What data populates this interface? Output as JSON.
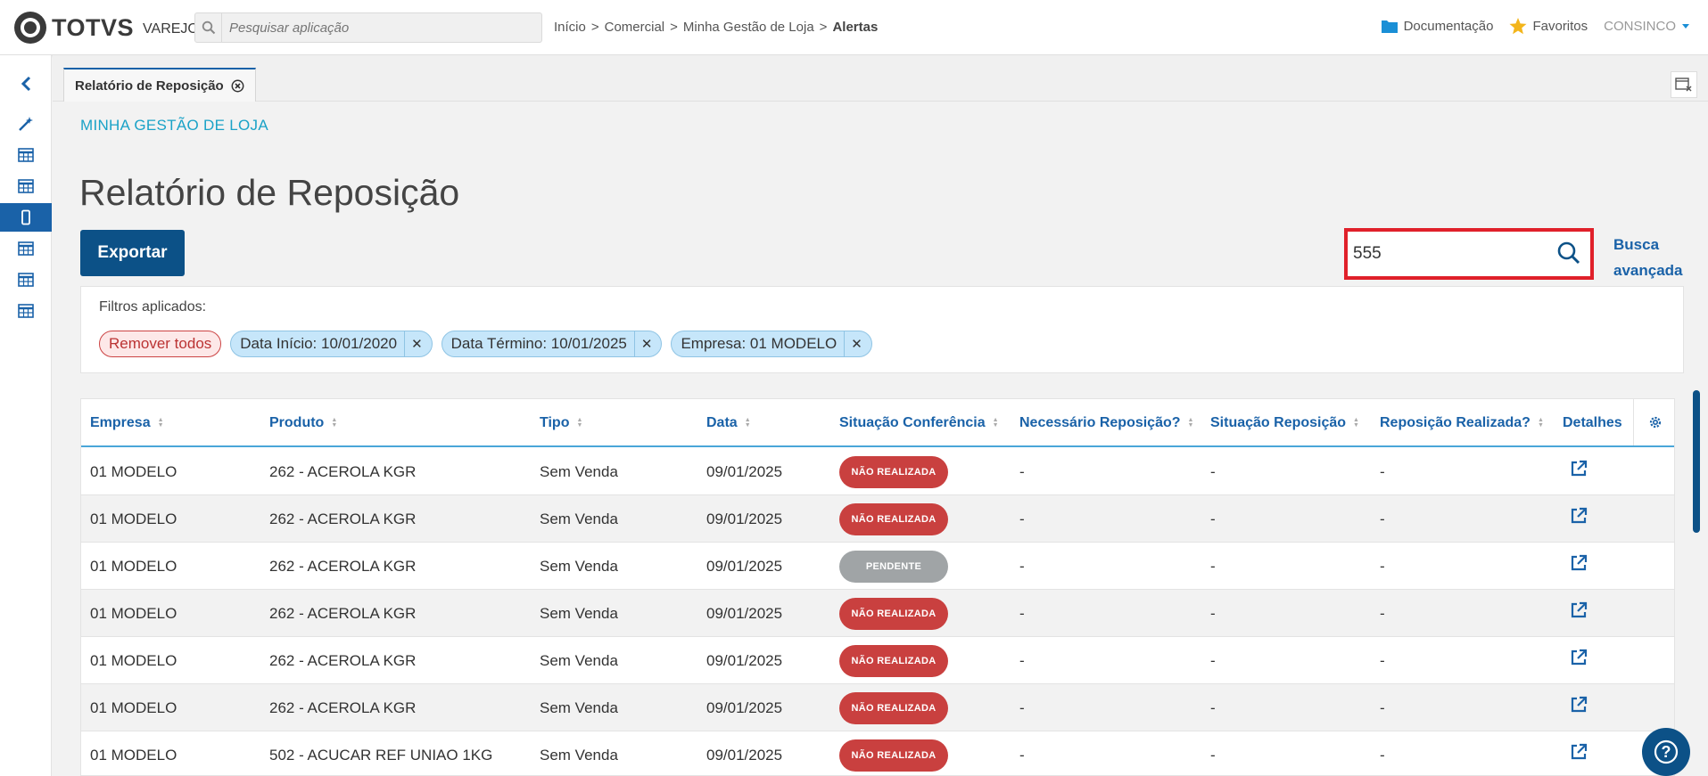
{
  "header": {
    "logo_text": "TOTVS",
    "logo_sub": "VAREJO",
    "search_placeholder": "Pesquisar aplicação",
    "breadcrumb": [
      "Início",
      ">",
      "Comercial",
      ">",
      "Minha Gestão de Loja",
      ">",
      "Alertas"
    ],
    "documentation_label": "Documentação",
    "favorites_label": "Favoritos",
    "user_label": "CONSINCO"
  },
  "tab": {
    "label": "Relatório de Reposição"
  },
  "page": {
    "section_label": "MINHA GESTÃO DE LOJA",
    "title": "Relatório de Reposição",
    "export_label": "Exportar",
    "search_value": "555",
    "advanced_search_line1": "Busca",
    "advanced_search_line2": "avançada"
  },
  "filters": {
    "title": "Filtros aplicados:",
    "remove_all_label": "Remover todos",
    "chips": [
      {
        "label": "Data Início: 10/01/2020"
      },
      {
        "label": "Data Término: 10/01/2025"
      },
      {
        "label": "Empresa: 01 MODELO"
      }
    ]
  },
  "table": {
    "columns": [
      "Empresa",
      "Produto",
      "Tipo",
      "Data",
      "Situação Conferência",
      "Necessário Reposição?",
      "Situação Reposição",
      "Reposição Realizada?",
      "Detalhes"
    ],
    "rows": [
      {
        "empresa": "01 MODELO",
        "produto": "262 - ACEROLA KGR",
        "tipo": "Sem Venda",
        "data": "09/01/2025",
        "situacao": "NÃO REALIZADA",
        "status": "red",
        "necessario": "-",
        "sit_repo": "-",
        "realizada": "-"
      },
      {
        "empresa": "01 MODELO",
        "produto": "262 - ACEROLA KGR",
        "tipo": "Sem Venda",
        "data": "09/01/2025",
        "situacao": "NÃO REALIZADA",
        "status": "red",
        "necessario": "-",
        "sit_repo": "-",
        "realizada": "-"
      },
      {
        "empresa": "01 MODELO",
        "produto": "262 - ACEROLA KGR",
        "tipo": "Sem Venda",
        "data": "09/01/2025",
        "situacao": "PENDENTE",
        "status": "gray",
        "necessario": "-",
        "sit_repo": "-",
        "realizada": "-"
      },
      {
        "empresa": "01 MODELO",
        "produto": "262 - ACEROLA KGR",
        "tipo": "Sem Venda",
        "data": "09/01/2025",
        "situacao": "NÃO REALIZADA",
        "status": "red",
        "necessario": "-",
        "sit_repo": "-",
        "realizada": "-"
      },
      {
        "empresa": "01 MODELO",
        "produto": "262 - ACEROLA KGR",
        "tipo": "Sem Venda",
        "data": "09/01/2025",
        "situacao": "NÃO REALIZADA",
        "status": "red",
        "necessario": "-",
        "sit_repo": "-",
        "realizada": "-"
      },
      {
        "empresa": "01 MODELO",
        "produto": "262 - ACEROLA KGR",
        "tipo": "Sem Venda",
        "data": "09/01/2025",
        "situacao": "NÃO REALIZADA",
        "status": "red",
        "necessario": "-",
        "sit_repo": "-",
        "realizada": "-"
      },
      {
        "empresa": "01 MODELO",
        "produto": "502 - ACUCAR REF UNIAO 1KG",
        "tipo": "Sem Venda",
        "data": "09/01/2025",
        "situacao": "NÃO REALIZADA",
        "status": "red",
        "necessario": "-",
        "sit_repo": "-",
        "realizada": "-"
      }
    ]
  },
  "colors": {
    "primary": "#0c5187",
    "accent": "#1a62a8",
    "section_label": "#1aa2c7",
    "badge_red": "#c9403f",
    "badge_gray": "#a0a4a6",
    "highlight_border": "#e0202a"
  }
}
